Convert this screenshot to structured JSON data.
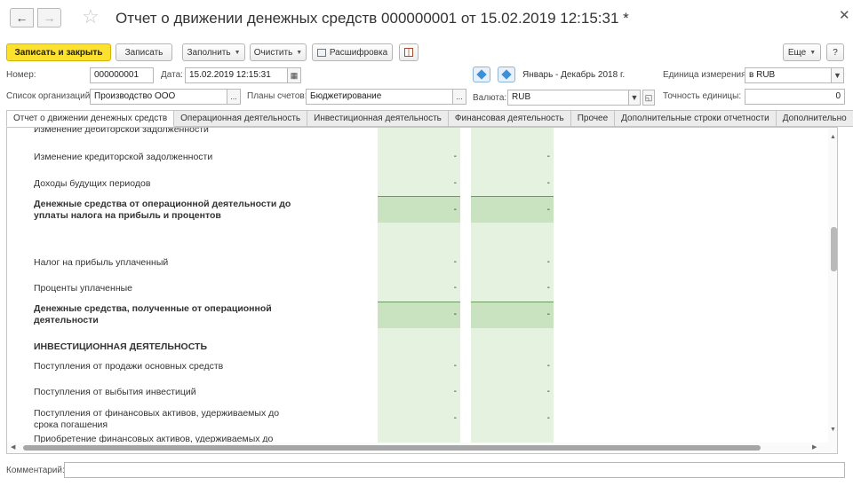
{
  "window": {
    "title": "Отчет о движении денежных средств 000000001 от 15.02.2019 12:15:31 *"
  },
  "toolbar": {
    "save_close": "Записать и закрыть",
    "save": "Записать",
    "fill": "Заполнить",
    "clear": "Очистить",
    "decode": "Расшифровка",
    "more": "Еще",
    "help": "?"
  },
  "form": {
    "number_label": "Номер:",
    "number_value": "000000001",
    "date_label": "Дата:",
    "date_value": "15.02.2019 12:15:31",
    "period_value": "Январь - Декабрь 2018 г.",
    "unit_label": "Единица измерения:",
    "unit_value": "в RUB",
    "org_label": "Список организаций:",
    "org_value": "Производство ООО",
    "plans_label": "Планы счетов:",
    "plans_value": "Бюджетирование",
    "currency_label": "Валюта:",
    "currency_value": "RUB",
    "precision_label": "Точность единицы:",
    "precision_value": "0",
    "ellipsis": "...",
    "comment_label": "Комментарий:"
  },
  "tabs": [
    "Отчет о движении денежных средств",
    "Операционная деятельность",
    "Инвестиционная деятельность",
    "Финансовая деятельность",
    "Прочее",
    "Дополнительные строки отчетности",
    "Дополнительно"
  ],
  "rows": [
    {
      "label": "Изменение дебиторской задолженности",
      "v1": "",
      "v2": ""
    },
    {
      "label": "Изменение кредиторской задолженности",
      "v1": "-",
      "v2": "-"
    },
    {
      "label": "Доходы будущих периодов",
      "v1": "-",
      "v2": "-"
    },
    {
      "label": "Денежные средства от операционной деятельности до уплаты налога на прибыль и процентов",
      "v1": "-",
      "v2": "-"
    },
    {
      "label": "Налог на прибыль уплаченный",
      "v1": "-",
      "v2": "-"
    },
    {
      "label": "Проценты уплаченные",
      "v1": "-",
      "v2": "-"
    },
    {
      "label": "Денежные средства, полученные от операционной деятельности",
      "v1": "-",
      "v2": "-"
    },
    {
      "label": "ИНВЕСТИЦИОННАЯ ДЕЯТЕЛЬНОСТЬ",
      "v1": "",
      "v2": ""
    },
    {
      "label": "Поступления от продажи основных средств",
      "v1": "-",
      "v2": "-"
    },
    {
      "label": "Поступления от выбытия инвестиций",
      "v1": "-",
      "v2": "-"
    },
    {
      "label": "Поступления от финансовых активов, удерживаемых до срока погашения",
      "v1": "-",
      "v2": "-"
    },
    {
      "label": "Приобретение финансовых активов, удерживаемых до",
      "v1": "",
      "v2": ""
    }
  ]
}
